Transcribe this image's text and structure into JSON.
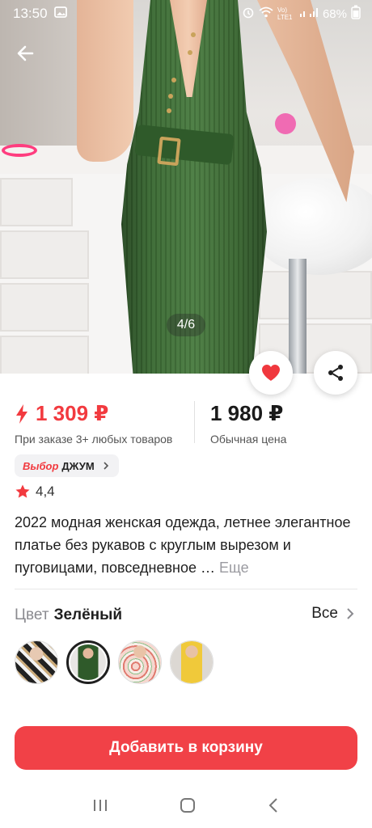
{
  "status_bar": {
    "time": "13:50",
    "battery": "68%",
    "network": "Vo) LTE1"
  },
  "gallery": {
    "counter": "4/6"
  },
  "price": {
    "promo": "1 309 ₽",
    "promo_note": "При заказе 3+ любых товаров",
    "regular": "1 980 ₽",
    "regular_note": "Обычная цена"
  },
  "choice_badge": {
    "brand": "Выбор",
    "name": "ДЖУМ"
  },
  "rating": {
    "value": "4,4"
  },
  "product": {
    "title": "2022 модная женская одежда, летнее элегантное платье без рукавов с круглым вырезом и пуговицами, повседневное … ",
    "more": "Еще"
  },
  "color": {
    "label": "Цвет",
    "selected": "Зелёный",
    "all": "Все",
    "swatches": [
      "Черно-белый",
      "Зелёный",
      "Цветочный",
      "Жёлтый"
    ]
  },
  "cart": {
    "button": "Добавить в корзину"
  },
  "colors": {
    "accent": "#f14147",
    "price_red": "#f23a3f"
  }
}
